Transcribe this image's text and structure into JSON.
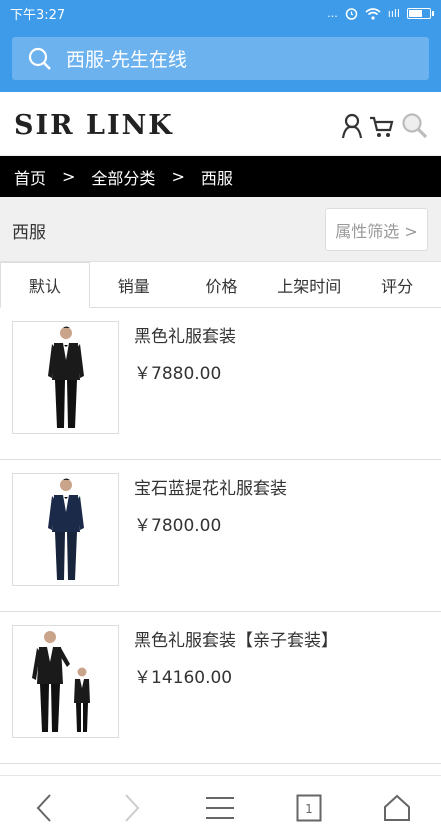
{
  "status": {
    "time": "下午3:27",
    "dots": "...",
    "signal": "ııll"
  },
  "browser": {
    "url_text": "西服-先生在线"
  },
  "header": {
    "logo": "SIR LINK"
  },
  "breadcrumb": {
    "home": "首页",
    "sep1": ">",
    "all": "全部分类",
    "sep2": ">",
    "current": "西服"
  },
  "category": {
    "title": "西服",
    "filter_label": "属性筛选 >"
  },
  "sort_tabs": [
    "默认",
    "销量",
    "价格",
    "上架时间",
    "评分"
  ],
  "products": [
    {
      "name": "黑色礼服套装",
      "price": "￥7880.00"
    },
    {
      "name": "宝石蓝提花礼服套装",
      "price": "￥7800.00"
    },
    {
      "name": "黑色礼服套装【亲子套装】",
      "price": "￥14160.00"
    }
  ],
  "bottom_nav": {
    "tab_count": "1"
  },
  "colors": {
    "accent": "#3d9be9",
    "url_bar": "#6cb2ef"
  }
}
